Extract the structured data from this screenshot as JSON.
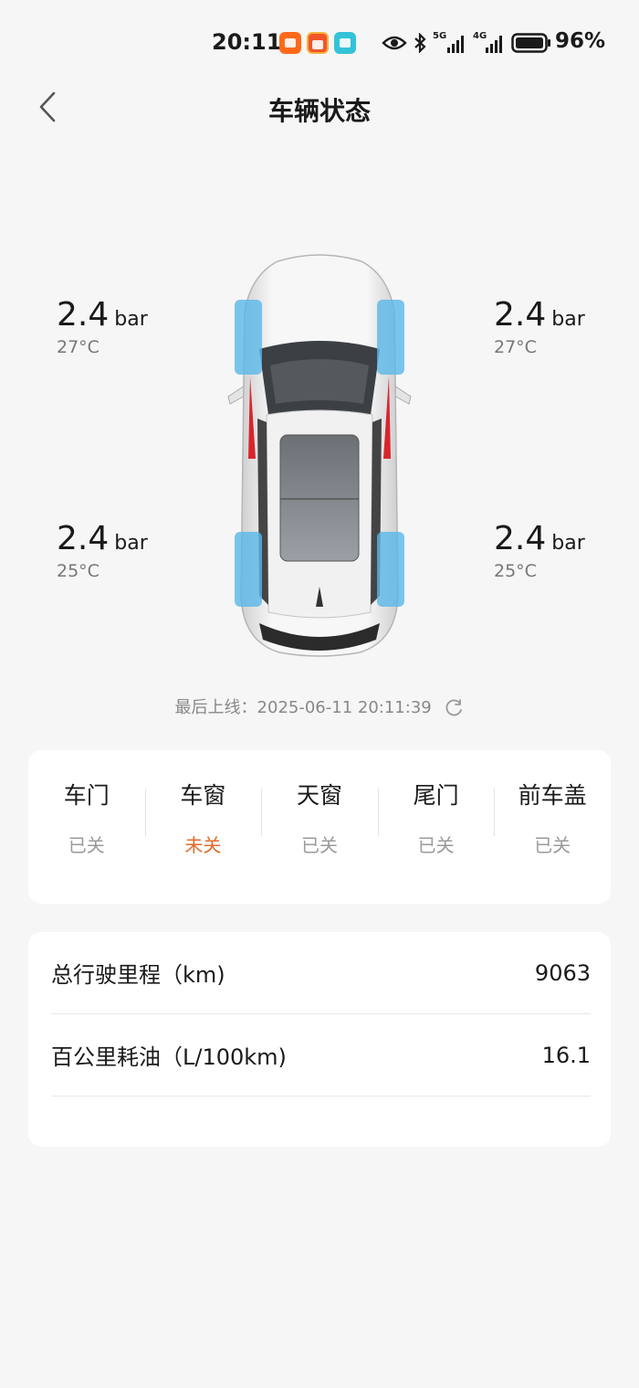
{
  "status_bar": {
    "time": "20:11",
    "battery": "96%",
    "network_1": "5G",
    "network_2": "4G",
    "icons": [
      "eye-icon",
      "bluetooth-icon",
      "signal-5g-icon",
      "signal-4g-icon",
      "battery-icon"
    ]
  },
  "header": {
    "title": "车辆状态",
    "back_icon": "chevron-left-icon"
  },
  "tires": {
    "front_left": {
      "pressure": "2.4",
      "unit": "bar",
      "temp": "27°C"
    },
    "front_right": {
      "pressure": "2.4",
      "unit": "bar",
      "temp": "27°C"
    },
    "rear_left": {
      "pressure": "2.4",
      "unit": "bar",
      "temp": "25°C"
    },
    "rear_right": {
      "pressure": "2.4",
      "unit": "bar",
      "temp": "25°C"
    }
  },
  "last_online": {
    "label": "最后上线：",
    "datetime": "2025-06-11 20:11:39"
  },
  "closures": [
    {
      "label": "车门",
      "value": "已关"
    },
    {
      "label": "车窗",
      "value": "未关"
    },
    {
      "label": "天窗",
      "value": "已关"
    },
    {
      "label": "尾门",
      "value": "已关"
    },
    {
      "label": "前车盖",
      "value": "已关"
    }
  ],
  "stats": [
    {
      "label": "总行驶里程（km)",
      "value": "9063"
    },
    {
      "label": "百公里耗油（L/100km)",
      "value": "16.1"
    }
  ],
  "colors": {
    "warning": "#e06a2b",
    "tire_highlight": "#5ab8e8",
    "tail_light": "#d7262c"
  }
}
